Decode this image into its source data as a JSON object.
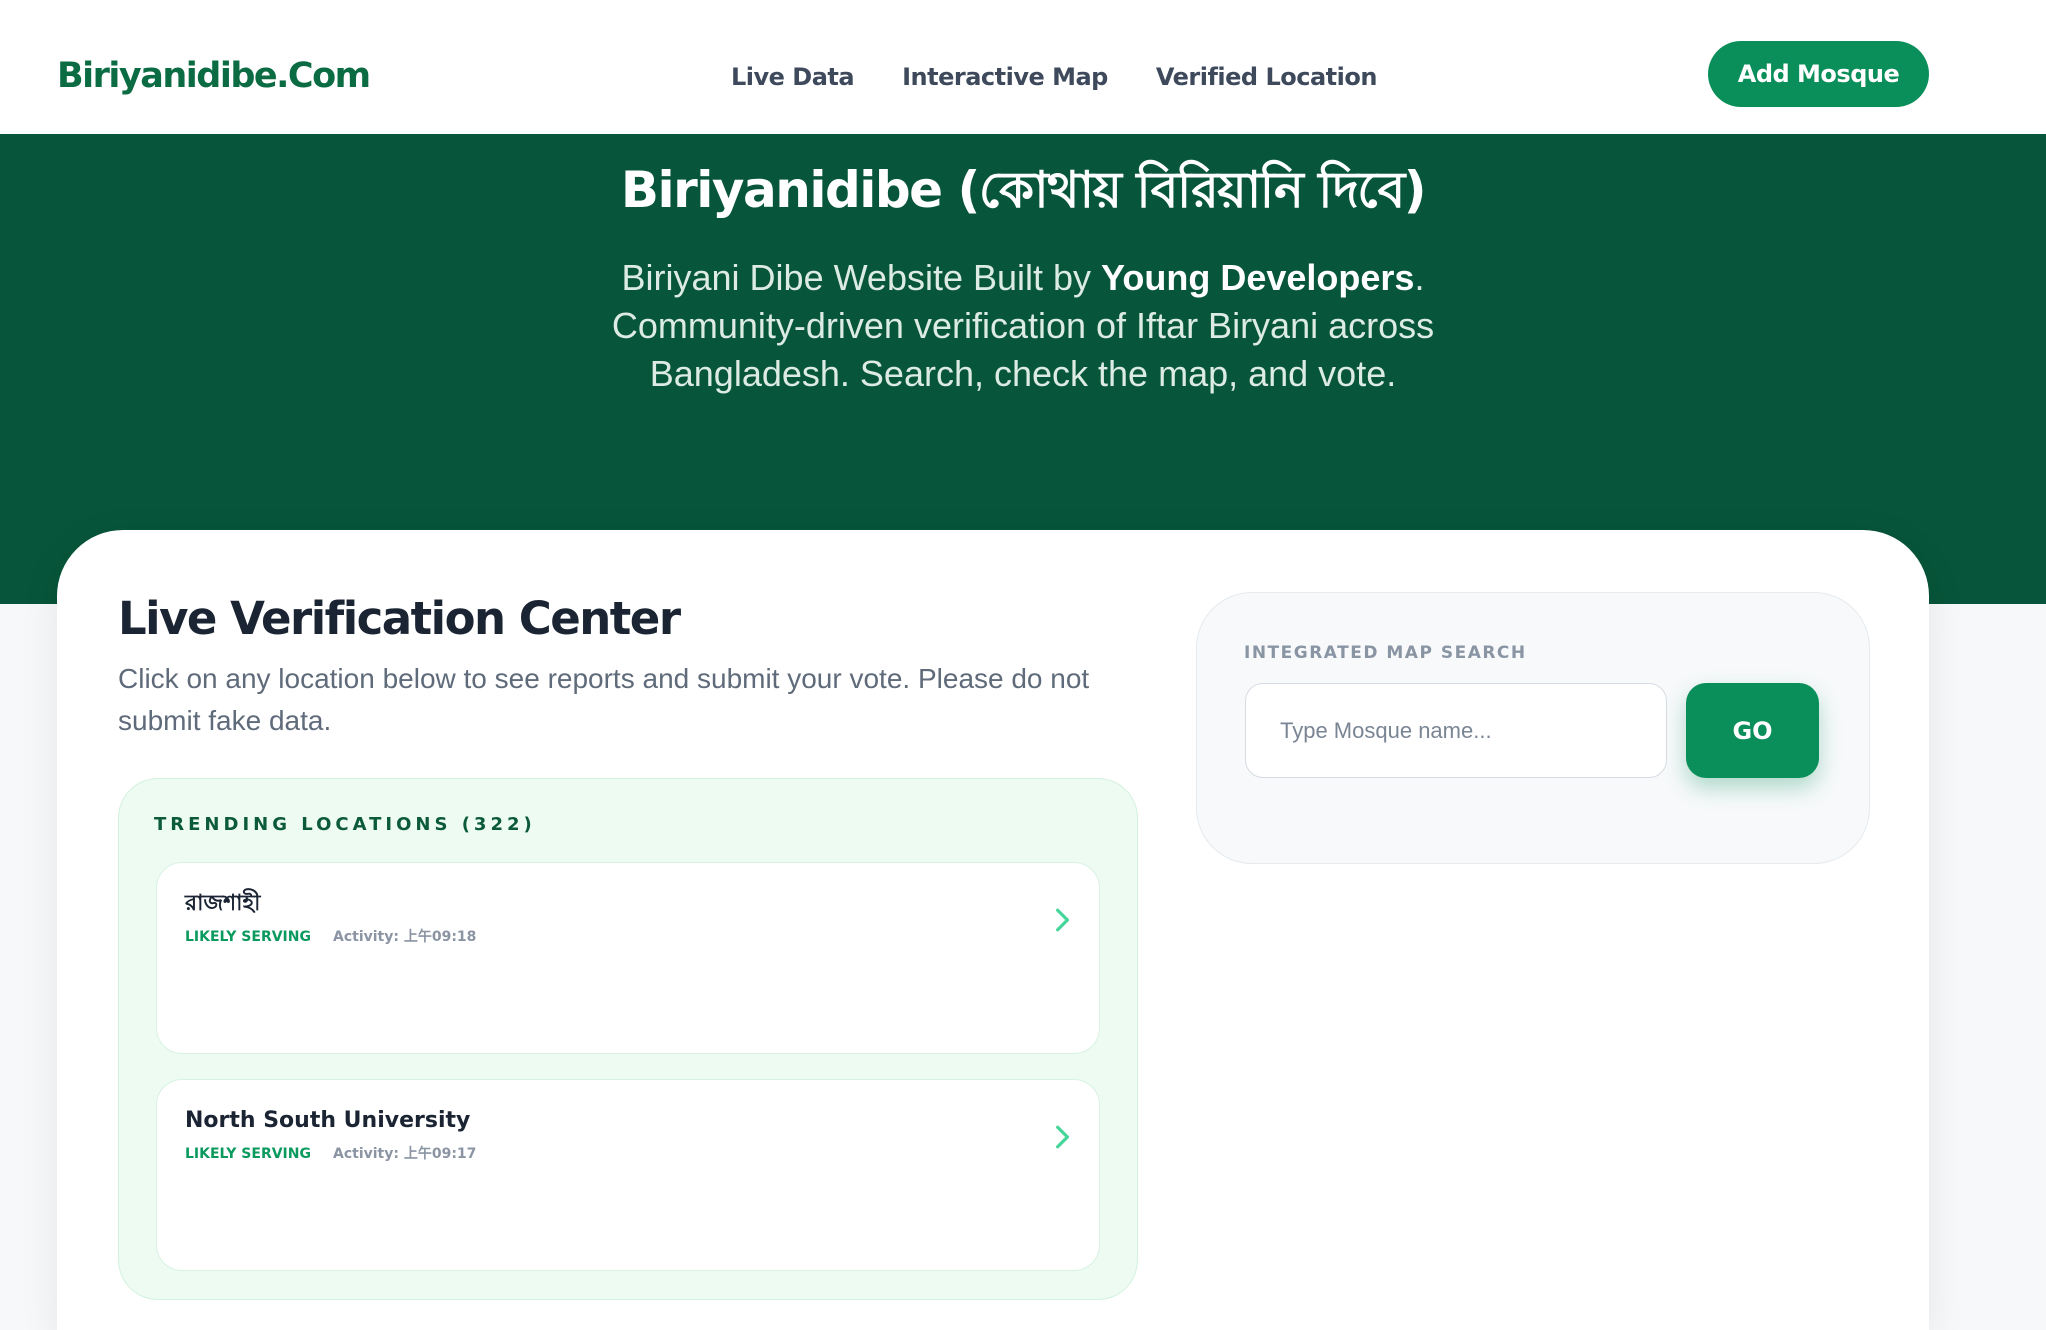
{
  "header": {
    "logo": "Biriyanidibe.Com",
    "nav": [
      "Live Data",
      "Interactive Map",
      "Verified Location"
    ],
    "cta_label": "Add Mosque"
  },
  "hero": {
    "title": "Biriyanidibe (কোথায় বিরিয়ানি দিবে)",
    "subtitle_prefix": "Biriyani Dibe Website Built by ",
    "subtitle_bold": "Young Developers",
    "subtitle_suffix": ". Community-driven verification of Iftar Biryani across Bangladesh. Search, check the map, and vote."
  },
  "verification": {
    "title": "Live Verification Center",
    "description": "Click on any location below to see reports and submit your vote. Please do not submit fake data."
  },
  "trending": {
    "label": "TRENDING LOCATIONS (322)",
    "items": [
      {
        "name": "রাজশাহী",
        "status": "LIKELY SERVING",
        "activity": "Activity: 上午09:18"
      },
      {
        "name": "North South University",
        "status": "LIKELY SERVING",
        "activity": "Activity: 上午09:17"
      }
    ]
  },
  "map_search": {
    "label": "INTEGRATED MAP SEARCH",
    "placeholder": "Type Mosque name...",
    "go_label": "GO"
  },
  "colors": {
    "brand": "#0a8f5a",
    "hero_bg": "#07553a",
    "trending_bg": "#edfbf3"
  },
  "icons": {
    "chevron": "chevron-right-icon"
  }
}
